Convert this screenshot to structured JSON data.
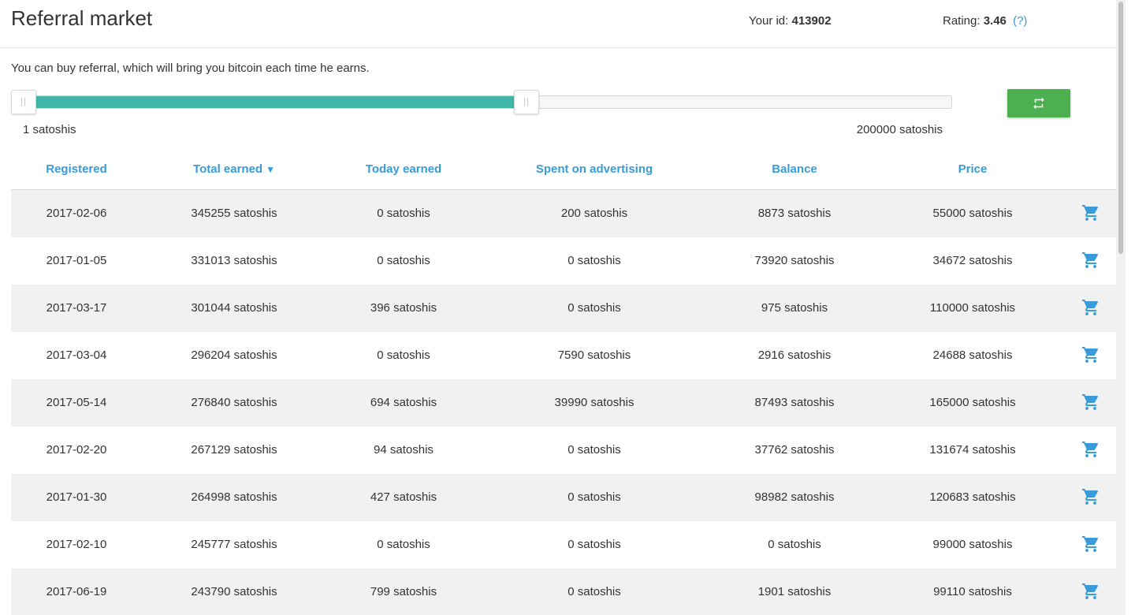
{
  "header": {
    "title": "Referral market",
    "id_label": "Your id:",
    "id_value": "413902",
    "rating_label": "Rating:",
    "rating_value": "3.46",
    "help_label": "(?)"
  },
  "description": "You can buy referral, which will bring you bitcoin each time he earns.",
  "price_filter": {
    "min_label": "1 satoshis",
    "max_label": "200000 satoshis",
    "selected_fraction_start": 0,
    "selected_fraction_end": 0.55,
    "fill_color": "#3fb6a8"
  },
  "refresh_button": {
    "icon": "swap-arrows-icon",
    "color": "#4caf50"
  },
  "table": {
    "columns": [
      "Registered",
      "Total earned",
      "Today earned",
      "Spent on advertising",
      "Balance",
      "Price"
    ],
    "sort_indicator": "▼",
    "rows": [
      [
        "2017-02-06",
        "345255 satoshis",
        "0 satoshis",
        "200 satoshis",
        "8873 satoshis",
        "55000 satoshis"
      ],
      [
        "2017-01-05",
        "331013 satoshis",
        "0 satoshis",
        "0 satoshis",
        "73920 satoshis",
        "34672 satoshis"
      ],
      [
        "2017-03-17",
        "301044 satoshis",
        "396 satoshis",
        "0 satoshis",
        "975 satoshis",
        "110000 satoshis"
      ],
      [
        "2017-03-04",
        "296204 satoshis",
        "0 satoshis",
        "7590 satoshis",
        "2916 satoshis",
        "24688 satoshis"
      ],
      [
        "2017-05-14",
        "276840 satoshis",
        "694 satoshis",
        "39990 satoshis",
        "87493 satoshis",
        "165000 satoshis"
      ],
      [
        "2017-02-20",
        "267129 satoshis",
        "94 satoshis",
        "0 satoshis",
        "37762 satoshis",
        "131674 satoshis"
      ],
      [
        "2017-01-30",
        "264998 satoshis",
        "427 satoshis",
        "0 satoshis",
        "98982 satoshis",
        "120683 satoshis"
      ],
      [
        "2017-02-10",
        "245777 satoshis",
        "0 satoshis",
        "0 satoshis",
        "0 satoshis",
        "99000 satoshis"
      ],
      [
        "2017-06-19",
        "243790 satoshis",
        "799 satoshis",
        "0 satoshis",
        "1901 satoshis",
        "99110 satoshis"
      ]
    ],
    "row_action_icon": "shopping-cart-icon",
    "accent_color": "#3a9bd8"
  }
}
